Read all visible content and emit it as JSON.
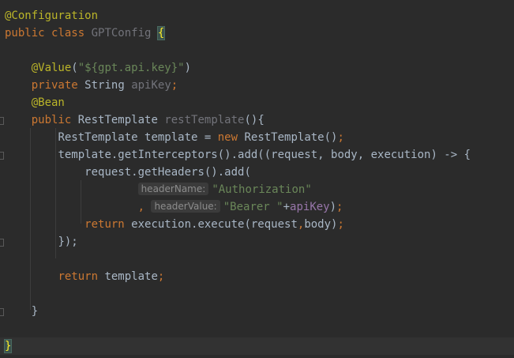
{
  "code": {
    "l1": {
      "annotation": "@Configuration"
    },
    "l2": {
      "kw": "public class",
      "classname": "GPTConfig",
      "brace": "{"
    },
    "l4": {
      "annotation": "@Value",
      "open": "(",
      "string": "\"${gpt.api.key}\"",
      "close": ")"
    },
    "l5": {
      "kw": "private",
      "type": "String",
      "field": "apiKey",
      "semi": ";"
    },
    "l6": {
      "annotation": "@Bean"
    },
    "l7": {
      "kw": "public",
      "type": "RestTemplate",
      "method": "restTemplate",
      "rest": "(){"
    },
    "l8": {
      "type": "RestTemplate template = ",
      "kw": "new",
      "rest": " RestTemplate()",
      "semi": ";"
    },
    "l9": {
      "text": "template.getInterceptors().add((request, body, execution) -> {"
    },
    "l10": {
      "text": "request.getHeaders().add("
    },
    "l11": {
      "hint": "headerName:",
      "string": "\"Authorization\""
    },
    "l12": {
      "comma": ",",
      "hint": "headerValue:",
      "string": "\"Bearer \"",
      "plus": "+",
      "field": "apiKey",
      "rest": ")",
      "semi": ";"
    },
    "l13": {
      "kw": "return",
      "rest": " execution.execute(request",
      "comma": ",",
      "rest2": "body)",
      "semi": ";"
    },
    "l14": {
      "text": "});"
    },
    "l16": {
      "kw": "return",
      "rest": " template",
      "semi": ";"
    },
    "l18": {
      "text": "}"
    },
    "l20": {
      "brace": "}"
    }
  }
}
